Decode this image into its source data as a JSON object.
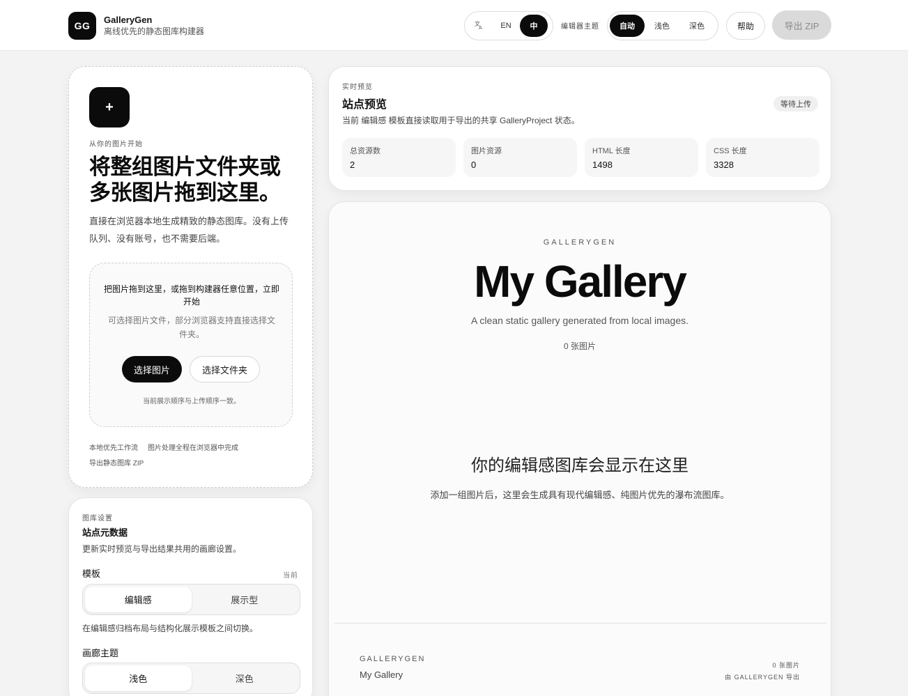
{
  "header": {
    "logo_text": "GG",
    "app_name": "GalleryGen",
    "app_subtitle": "离线优先的静态图库构建器",
    "language": {
      "icon": "translate-icon",
      "options": [
        "EN",
        "中"
      ],
      "selected": "中"
    },
    "theme_label": "编辑器主题",
    "theme": {
      "options": [
        "自动",
        "浅色",
        "深色"
      ],
      "selected": "自动"
    },
    "help_label": "帮助",
    "export_label": "导出 ZIP"
  },
  "upload": {
    "plus_icon": "+",
    "eyebrow": "从你的图片开始",
    "title": "将整组图片文件夹或多张图片拖到这里。",
    "description": "直接在浏览器本地生成精致的静态图库。没有上传队列、没有账号，也不需要后端。",
    "dropzone_title": "把图片拖到这里，或拖到构建器任意位置，立即开始",
    "dropzone_hint": "可选择图片文件，部分浏览器支持直接选择文件夹。",
    "select_images": "选择图片",
    "select_folder": "选择文件夹",
    "order_note": "当前展示顺序与上传顺序一致。",
    "features": [
      "本地优先工作流",
      "图片处理全程在浏览器中完成",
      "导出静态图库 ZIP"
    ]
  },
  "settings": {
    "eyebrow": "图库设置",
    "title": "站点元数据",
    "description": "更新实时预览与导出结果共用的画廊设置。",
    "template_label": "模板",
    "template_meta": "当前",
    "template_options": [
      "编辑感",
      "展示型"
    ],
    "template_selected": "编辑感",
    "template_note": "在编辑感归档布局与结构化展示模板之间切换。",
    "gallery_theme_label": "画廊主题",
    "gallery_theme_options": [
      "浅色",
      "深色"
    ],
    "gallery_theme_selected": "浅色"
  },
  "preview": {
    "eyebrow": "实时预览",
    "title": "站点预览",
    "description": "当前 编辑感 模板直接读取用于导出的共享 GalleryProject 状态。",
    "status": "等待上传",
    "stats": [
      {
        "label": "总资源数",
        "value": "2"
      },
      {
        "label": "图片资源",
        "value": "0"
      },
      {
        "label": "HTML 长度",
        "value": "1498"
      },
      {
        "label": "CSS 长度",
        "value": "3328"
      }
    ]
  },
  "gallery": {
    "eyebrow": "GALLERYGEN",
    "title": "My Gallery",
    "subtitle": "A clean static gallery generated from local images.",
    "count": "0 张图片",
    "empty_title": "你的编辑感图库会显示在这里",
    "empty_desc": "添加一组图片后，这里会生成具有现代编辑感、纯图片优先的瀑布流图库。",
    "footer_eyebrow": "GALLERYGEN",
    "footer_name": "My Gallery",
    "footer_count": "0 张图片",
    "footer_credit": "由 GALLERYGEN 导出"
  },
  "colors": {
    "accent": "#0b0b0b",
    "background": "#f3f3f3",
    "card": "#ffffff",
    "disabled": "#dadada"
  }
}
